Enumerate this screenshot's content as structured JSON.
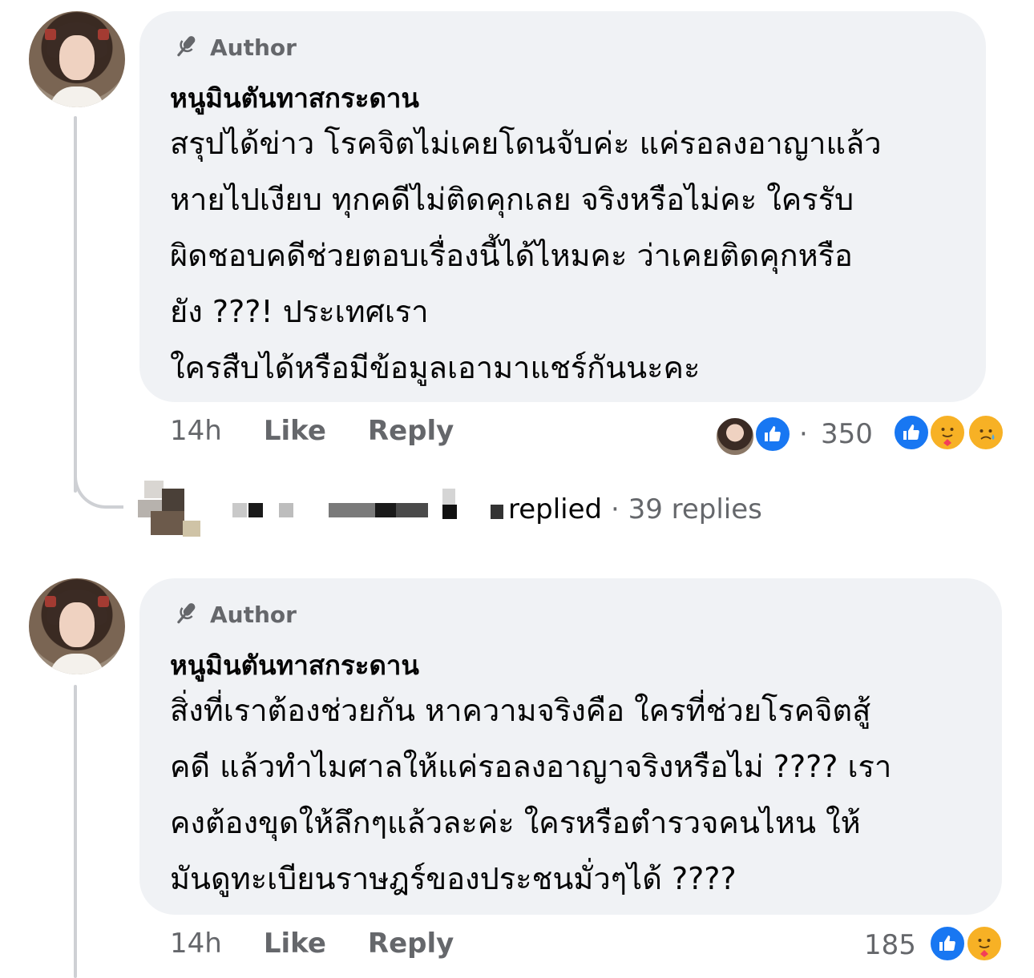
{
  "comments": [
    {
      "author_badge": "Author",
      "name": "หนูมินตันทาสกระดาน",
      "lines": [
        "สรุปได้ข่าว โรคจิตไม่เคยโดนจับค่ะ แค่รอลงอาญาแล้ว",
        "หายไปเงียบ ทุกคดีไม่ติดคุกเลย จริงหรือไม่คะ ใครรับ",
        "ผิดชอบคดีช่วยตอบเรื่องนี้ได้ไหมคะ ว่าเคยติดคุกหรือ",
        "ยัง ???! ประเทศเรา",
        "ใครสืบได้หรือมีข้อมูลเอามาแชร์กันนะคะ"
      ],
      "time": "14h",
      "like_label": "Like",
      "reply_label": "Reply",
      "reaction_separator": "·",
      "reaction_count": "350",
      "reactions": [
        "like-icon",
        "care-icon",
        "sad-icon"
      ]
    },
    {
      "author_badge": "Author",
      "name": "หนูมินตันทาสกระดาน",
      "lines": [
        "สิ่งที่เราต้องช่วยกัน หาความจริงคือ ใครที่ช่วยโรคจิตสู้",
        "คดี แล้วทำไมศาลให้แค่รอลงอาญาจริงหรือไม่ ???? เรา",
        "คงต้องขุดให้ลึกๆแล้วละค่ะ ใครหรือตำรวจคนไหน ให้",
        "มันดูทะเบียนราษฎร์ของประชนมั่วๆได้ ????"
      ],
      "time": "14h",
      "like_label": "Like",
      "reply_label": "Reply",
      "reaction_count": "185",
      "reactions": [
        "like-icon",
        "care-icon"
      ]
    }
  ],
  "replies_summary": {
    "replied_text": "replied",
    "separator": "·",
    "count_text": "39 replies"
  },
  "colors": {
    "bubble": "#f0f2f5",
    "secondary_text": "#65676b",
    "like_blue": "#1877f2",
    "emoji_yellow": "#f7b125"
  }
}
